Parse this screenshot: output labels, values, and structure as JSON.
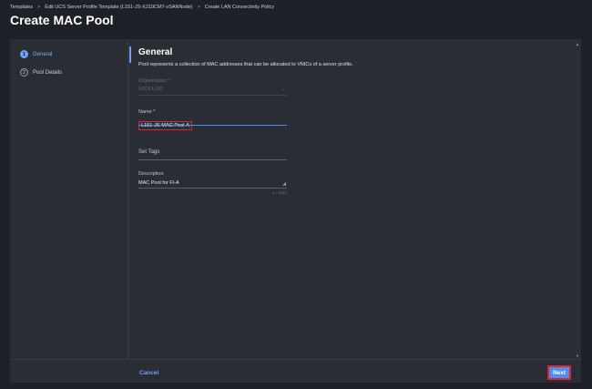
{
  "breadcrumb": {
    "items": [
      "Templates",
      "Edit UCS Server Profile Template (L151-JS-X210CM7-vSANNode)",
      "Create LAN Connectivity Policy"
    ],
    "separator": ">"
  },
  "page_title": "Create MAC Pool",
  "steps": [
    {
      "number": "1",
      "label": "General",
      "active": true
    },
    {
      "number": "2",
      "label": "Pool Details",
      "active": false
    }
  ],
  "section": {
    "title": "General",
    "description": "Pool represents a collection of MAC addresses that can be allocated to VNICs of a server profile."
  },
  "form": {
    "organization": {
      "label": "Organization *",
      "value": "IUCS-L151"
    },
    "name": {
      "label": "Name *",
      "value": "L151-JS-MAC-Pool-A"
    },
    "tags": {
      "label": "Set Tags"
    },
    "description": {
      "label": "Description",
      "value": "MAC Pool for FI-A",
      "char_count": "<= 1024"
    }
  },
  "footer": {
    "cancel_label": "Cancel",
    "next_label": "Next"
  },
  "icons": {
    "collapse": "chevron-left-icon",
    "dropdown": "chevron-down-icon",
    "resize": "resize-grip-icon"
  },
  "colors": {
    "accent": "#6da3ff",
    "primary_button": "#4f8df5",
    "highlight_border": "#d9262c",
    "background": "#1d2026",
    "panel": "#2a2d33"
  }
}
